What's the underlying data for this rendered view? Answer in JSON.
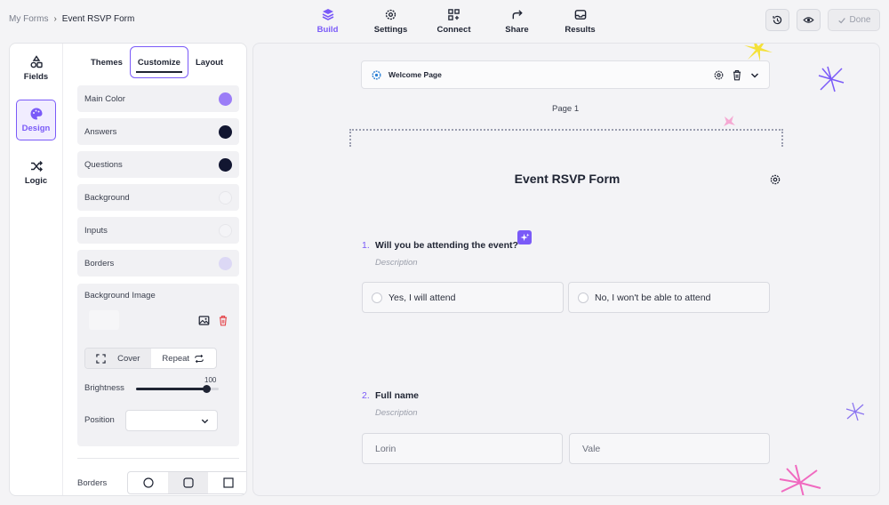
{
  "breadcrumb": {
    "root": "My Forms",
    "separator": "›",
    "current": "Event RSVP Form"
  },
  "nav": [
    {
      "label": "Build",
      "icon": "layers-icon",
      "active": true
    },
    {
      "label": "Settings",
      "icon": "gear-icon",
      "active": false
    },
    {
      "label": "Connect",
      "icon": "grid-connect-icon",
      "active": false
    },
    {
      "label": "Share",
      "icon": "share-arrow-icon",
      "active": false
    },
    {
      "label": "Results",
      "icon": "inbox-icon",
      "active": false
    }
  ],
  "actions": {
    "history_icon": "history-icon",
    "preview_icon": "eye-icon",
    "done_label": "Done"
  },
  "rail": [
    {
      "label": "Fields",
      "icon": "shapes-icon"
    },
    {
      "label": "Design",
      "icon": "palette-icon",
      "active": true
    },
    {
      "label": "Logic",
      "icon": "shuffle-icon"
    }
  ],
  "tabs": {
    "themes": "Themes",
    "customize": "Customize",
    "layout": "Layout"
  },
  "colors": [
    {
      "label": "Main Color",
      "value": "#9b7df7"
    },
    {
      "label": "Answers",
      "value": "#121631"
    },
    {
      "label": "Questions",
      "value": "#121631"
    },
    {
      "label": "Background",
      "value": "#f4f4f7"
    },
    {
      "label": "Inputs",
      "value": "#f4f4f7"
    },
    {
      "label": "Borders",
      "value": "#dcd8f5"
    }
  ],
  "background_image": {
    "title": "Background Image",
    "fit_options": [
      "Cover",
      "Repeat"
    ],
    "selected_fit": "Cover",
    "brightness_label": "Brightness",
    "brightness_value": "100",
    "brightness_fraction": 0.85,
    "position_label": "Position",
    "position_value": ""
  },
  "borders": {
    "label": "Borders",
    "options": [
      "round",
      "rounded",
      "square"
    ],
    "selected": "rounded"
  },
  "canvas": {
    "welcome_label": "Welcome Page",
    "page_label": "Page 1",
    "form_title": "Event RSVP Form",
    "q1": {
      "number": "1.",
      "text": "Will you be attending the event?",
      "description": "Description",
      "choices": [
        "Yes, I will attend",
        "No, I won't be able to attend"
      ]
    },
    "q2": {
      "number": "2.",
      "text": "Full name",
      "description": "Description",
      "first": "Lorin",
      "last": "Vale"
    }
  },
  "accent_color": "#7a5af8"
}
